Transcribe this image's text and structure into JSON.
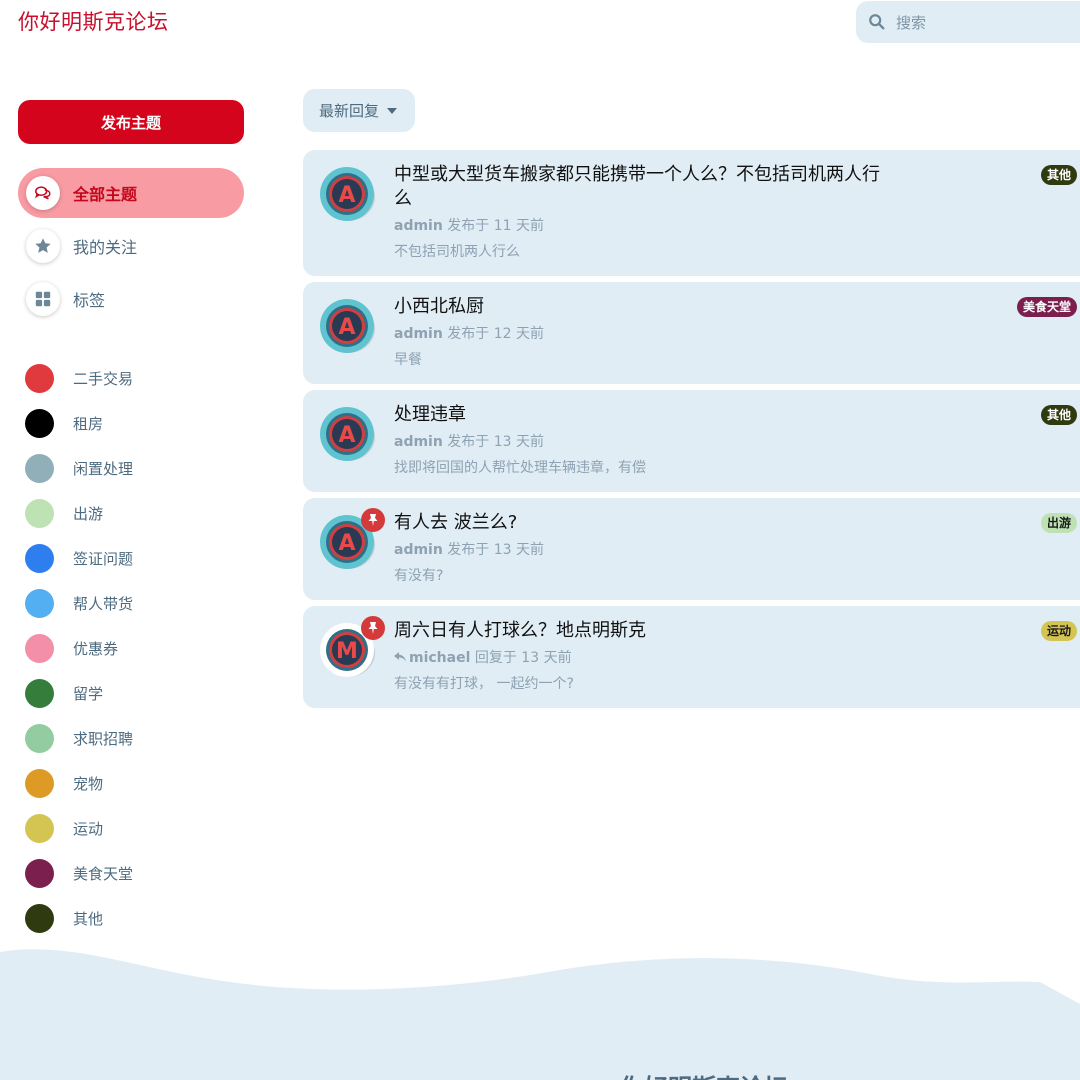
{
  "header": {
    "brand": "你好明斯克论坛",
    "search": {
      "placeholder": "搜索",
      "icon": "search-icon"
    }
  },
  "sidebar": {
    "post_button": "发布主题",
    "nav": [
      {
        "label": "全部主题",
        "icon": "comments-icon",
        "active": true
      },
      {
        "label": "我的关注",
        "icon": "star-icon",
        "active": false
      },
      {
        "label": "标签",
        "icon": "grid-icon",
        "active": false
      }
    ],
    "tags": [
      {
        "label": "二手交易",
        "color": "#e0393e"
      },
      {
        "label": "租房",
        "color": "#000000"
      },
      {
        "label": "闲置处理",
        "color": "#90afb8"
      },
      {
        "label": "出游",
        "color": "#bfe2b4"
      },
      {
        "label": "签证问题",
        "color": "#2f7ef0"
      },
      {
        "label": "帮人带货",
        "color": "#53aef2"
      },
      {
        "label": "优惠券",
        "color": "#f48fa9"
      },
      {
        "label": "留学",
        "color": "#357d3a"
      },
      {
        "label": "求职招聘",
        "color": "#93cca0"
      },
      {
        "label": "宠物",
        "color": "#dd9a24"
      },
      {
        "label": "运动",
        "color": "#d4c552"
      },
      {
        "label": "美食天堂",
        "color": "#7b1f4f"
      },
      {
        "label": "其他",
        "color": "#2f3a10"
      }
    ]
  },
  "toolbar": {
    "sort_label": "最新回复"
  },
  "discussions": [
    {
      "title": "中型或大型货车搬家都只能携带一个人么？不包括司机两人行么",
      "user": "admin",
      "action": "发布于 11 天前",
      "excerpt": "不包括司机两人行么",
      "tag": "其他",
      "tag_bg": "#2f3a10",
      "tag_fg": "#ffffff",
      "avatar": "A",
      "pinned": false,
      "reply": false
    },
    {
      "title": "小西北私厨",
      "user": "admin",
      "action": "发布于 12 天前",
      "excerpt": "早餐",
      "tag": "美食天堂",
      "tag_bg": "#7b1f4f",
      "tag_fg": "#ffffff",
      "avatar": "A",
      "pinned": false,
      "reply": false
    },
    {
      "title": "处理违章",
      "user": "admin",
      "action": "发布于 13 天前",
      "excerpt": "找即将回国的人帮忙处理车辆违章，有偿",
      "tag": "其他",
      "tag_bg": "#2f3a10",
      "tag_fg": "#ffffff",
      "avatar": "A",
      "pinned": false,
      "reply": false
    },
    {
      "title": "有人去 波兰么?",
      "user": "admin",
      "action": "发布于 13 天前",
      "excerpt": "有没有?",
      "tag": "出游",
      "tag_bg": "#bfe2b4",
      "tag_fg": "#1a1a1a",
      "avatar": "A",
      "pinned": true,
      "reply": false
    },
    {
      "title": "周六日有人打球么？地点明斯克",
      "user": "michael",
      "action": "回复于 13 天前",
      "excerpt": "有没有有打球， 一起约一个?",
      "tag": "运动",
      "tag_bg": "#d4c552",
      "tag_fg": "#1a1a1a",
      "avatar": "M",
      "pinned": true,
      "reply": true
    }
  ],
  "footer": {
    "title": "你好明斯克论坛"
  }
}
